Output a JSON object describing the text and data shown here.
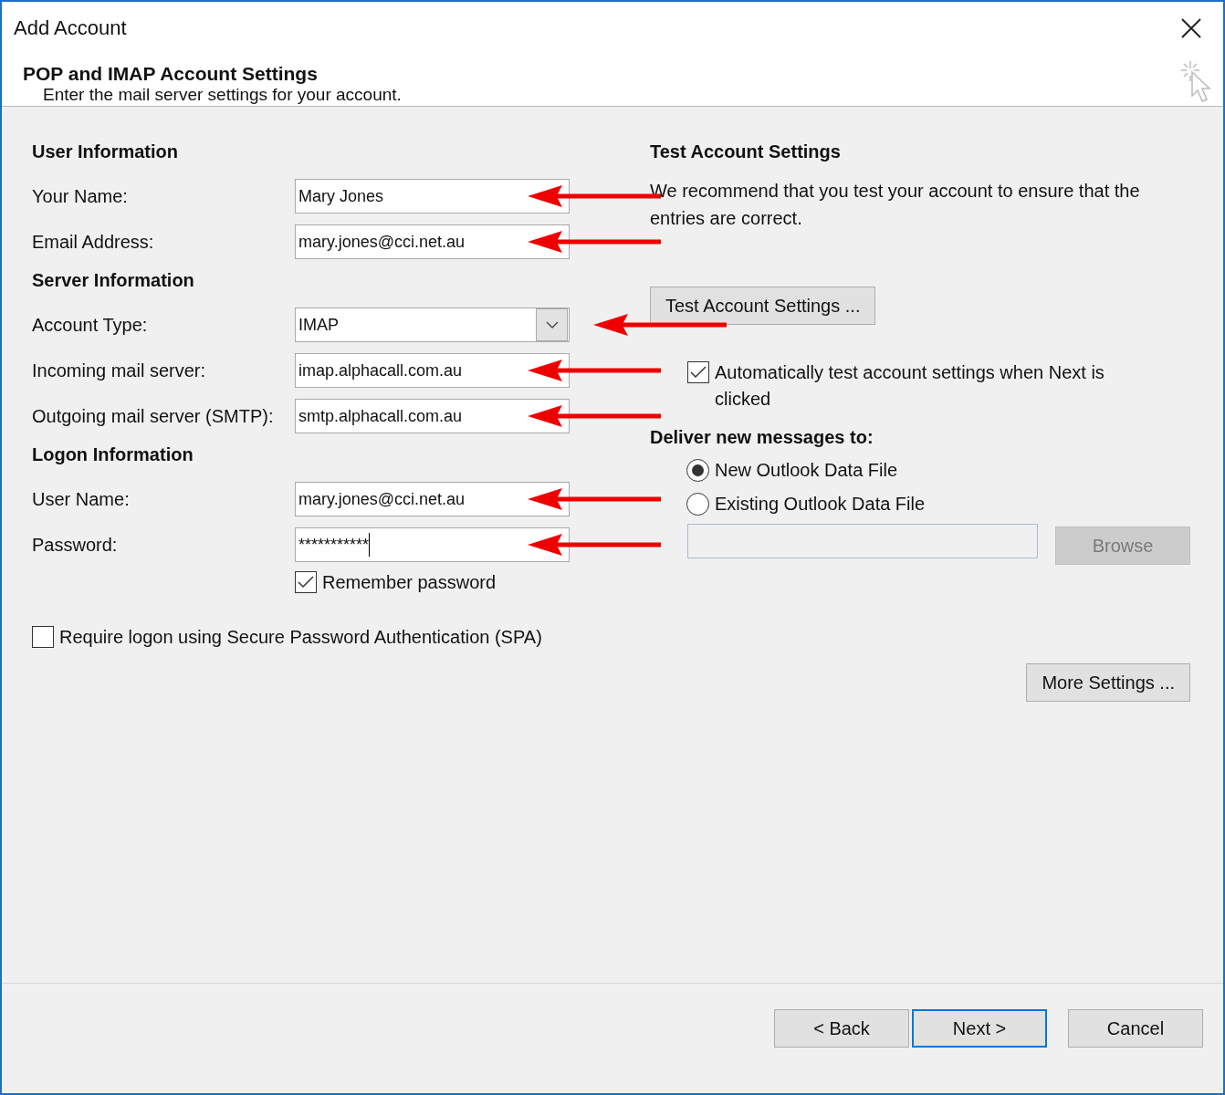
{
  "window": {
    "title": "Add Account"
  },
  "header": {
    "title": "POP and IMAP Account Settings",
    "subtitle": "Enter the mail server settings for your account."
  },
  "sections": [
    {
      "heading": "User Information",
      "fields": [
        {
          "label": "Your Name:",
          "value": "Mary Jones",
          "kind": "text",
          "annotated": true
        },
        {
          "label": "Email Address:",
          "value": "mary.jones@cci.net.au",
          "kind": "text",
          "annotated": true
        }
      ]
    },
    {
      "heading": "Server Information",
      "fields": [
        {
          "label": "Account Type:",
          "value": "IMAP",
          "kind": "dropdown",
          "annotated": true
        },
        {
          "label": "Incoming mail server:",
          "value": "imap.alphacall.com.au",
          "kind": "text",
          "annotated": true
        },
        {
          "label": "Outgoing mail server (SMTP):",
          "value": "smtp.alphacall.com.au",
          "kind": "text",
          "annotated": true
        }
      ]
    },
    {
      "heading": "Logon Information",
      "fields": [
        {
          "label": "User Name:",
          "value": "mary.jones@cci.net.au",
          "kind": "text",
          "annotated": true
        },
        {
          "label": "Password:",
          "value": "***********",
          "kind": "password",
          "annotated": true
        }
      ]
    }
  ],
  "remember_password": {
    "label": "Remember password",
    "checked": true
  },
  "spa": {
    "label": "Require logon using Secure Password Authentication (SPA)",
    "checked": false
  },
  "test": {
    "heading": "Test Account Settings",
    "description": "We recommend that you test your account to ensure that the entries are correct.",
    "button": "Test Account Settings ...",
    "auto_test": {
      "label": "Automatically test account settings when Next is clicked",
      "checked": true
    }
  },
  "deliver": {
    "heading": "Deliver new messages to:",
    "options": [
      {
        "label": "New Outlook Data File",
        "selected": true
      },
      {
        "label": "Existing Outlook Data File",
        "selected": false
      }
    ],
    "browse": "Browse"
  },
  "more_settings": "More Settings ...",
  "buttons": [
    {
      "label": "< Back",
      "default": false
    },
    {
      "label": "Next >",
      "default": true
    },
    {
      "label": "Cancel",
      "default": false
    }
  ]
}
